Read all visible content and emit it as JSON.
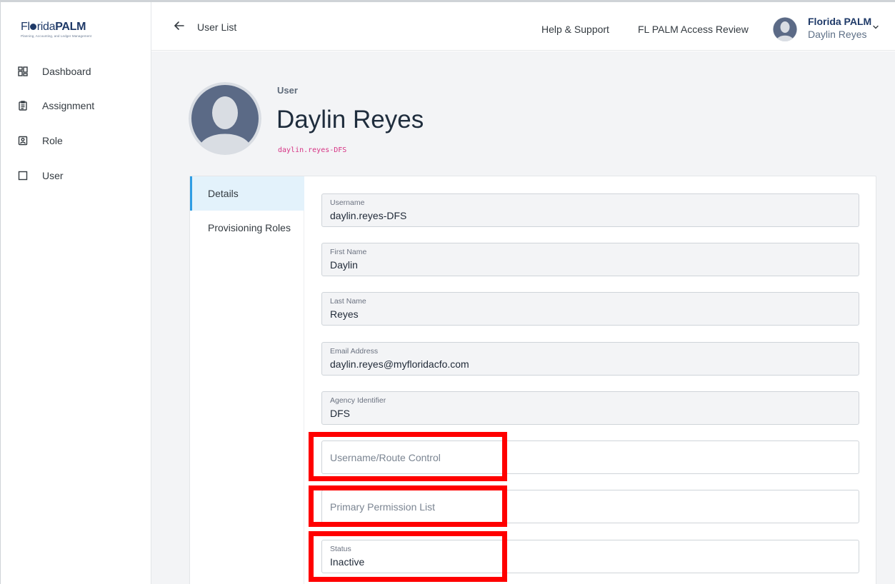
{
  "brand": {
    "florida": "Fl",
    "florida_tail": "rida",
    "palm": "PALM",
    "tagline": "Planning, Accounting, and Ledger Management"
  },
  "sidebar": {
    "items": [
      {
        "label": "Dashboard",
        "icon": "dashboard-icon"
      },
      {
        "label": "Assignment",
        "icon": "clipboard-icon"
      },
      {
        "label": "Role",
        "icon": "id-badge-icon"
      },
      {
        "label": "User",
        "icon": "square-icon"
      }
    ]
  },
  "header": {
    "back_label": "User List",
    "help_link": "Help & Support",
    "review_link": "FL PALM Access Review",
    "org_name": "Florida PALM",
    "user_name": "Daylin Reyes"
  },
  "profile": {
    "kicker": "User",
    "name": "Daylin Reyes",
    "handle": "daylin.reyes-DFS"
  },
  "tabs": [
    {
      "label": "Details",
      "active": true
    },
    {
      "label": "Provisioning Roles",
      "active": false
    }
  ],
  "fields": [
    {
      "label": "Username",
      "value": "daylin.reyes-DFS"
    },
    {
      "label": "First Name",
      "value": "Daylin"
    },
    {
      "label": "Last Name",
      "value": "Reyes"
    },
    {
      "label": "Email Address",
      "value": "daylin.reyes@myfloridacfo.com"
    },
    {
      "label": "Agency Identifier",
      "value": "DFS"
    },
    {
      "placeholder": "Username/Route Control"
    },
    {
      "placeholder": "Primary Permission List"
    },
    {
      "label": "Status",
      "value": "Inactive"
    }
  ],
  "colors": {
    "brand": "#1f3a68",
    "accent": "#2f9de4",
    "highlight": "#ff0000",
    "handle": "#d63384"
  }
}
